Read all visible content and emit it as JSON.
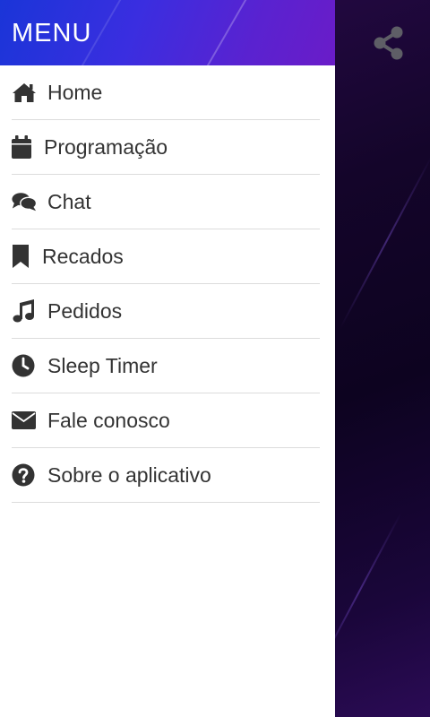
{
  "drawer": {
    "title": "MENU",
    "items": [
      {
        "label": "Home",
        "icon": "home-icon"
      },
      {
        "label": "Programação",
        "icon": "calendar-icon"
      },
      {
        "label": "Chat",
        "icon": "chat-icon"
      },
      {
        "label": "Recados",
        "icon": "bookmark-icon"
      },
      {
        "label": "Pedidos",
        "icon": "music-note-icon"
      },
      {
        "label": "Sleep Timer",
        "icon": "clock-icon"
      },
      {
        "label": "Fale conosco",
        "icon": "envelope-icon"
      },
      {
        "label": "Sobre o aplicativo",
        "icon": "question-circle-icon"
      }
    ]
  },
  "topbar": {
    "share_icon": "share-icon"
  },
  "colors": {
    "header_gradient_start": "#1a35d8",
    "header_gradient_end": "#6a1cc8",
    "menu_text": "#333333",
    "icon": "#333333",
    "divider": "#dcdcdc",
    "background": "#14052a"
  }
}
